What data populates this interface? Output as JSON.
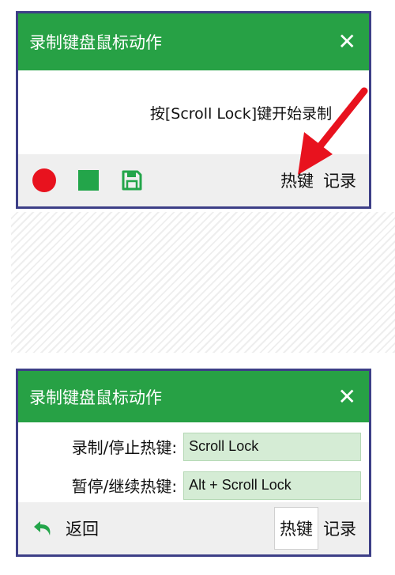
{
  "record_window": {
    "title": "录制键盘鼠标动作",
    "close_glyph": "✕",
    "hint": "按[Scroll Lock]键开始录制",
    "toolbar": {
      "record_icon": "record-circle-icon",
      "stop_icon": "stop-square-icon",
      "save_icon": "floppy-save-icon",
      "hotkey_label": "热键",
      "record_label": "记录"
    },
    "annotation_arrow_color": "#e8121e"
  },
  "hotkey_window": {
    "title": "录制键盘鼠标动作",
    "close_glyph": "✕",
    "fields": [
      {
        "label": "录制/停止热键:",
        "value": "Scroll Lock"
      },
      {
        "label": "暂停/继续热键:",
        "value": "Alt + Scroll Lock"
      }
    ],
    "back_label": "返回",
    "back_icon": "back-arrow-icon",
    "hotkey_label": "热键",
    "record_label": "记录"
  },
  "colors": {
    "titlebar": "#27a145",
    "border": "#3d3f87",
    "record_red": "#e8121e",
    "stop_green": "#23a54a",
    "input_bg": "#d5ecd5"
  }
}
